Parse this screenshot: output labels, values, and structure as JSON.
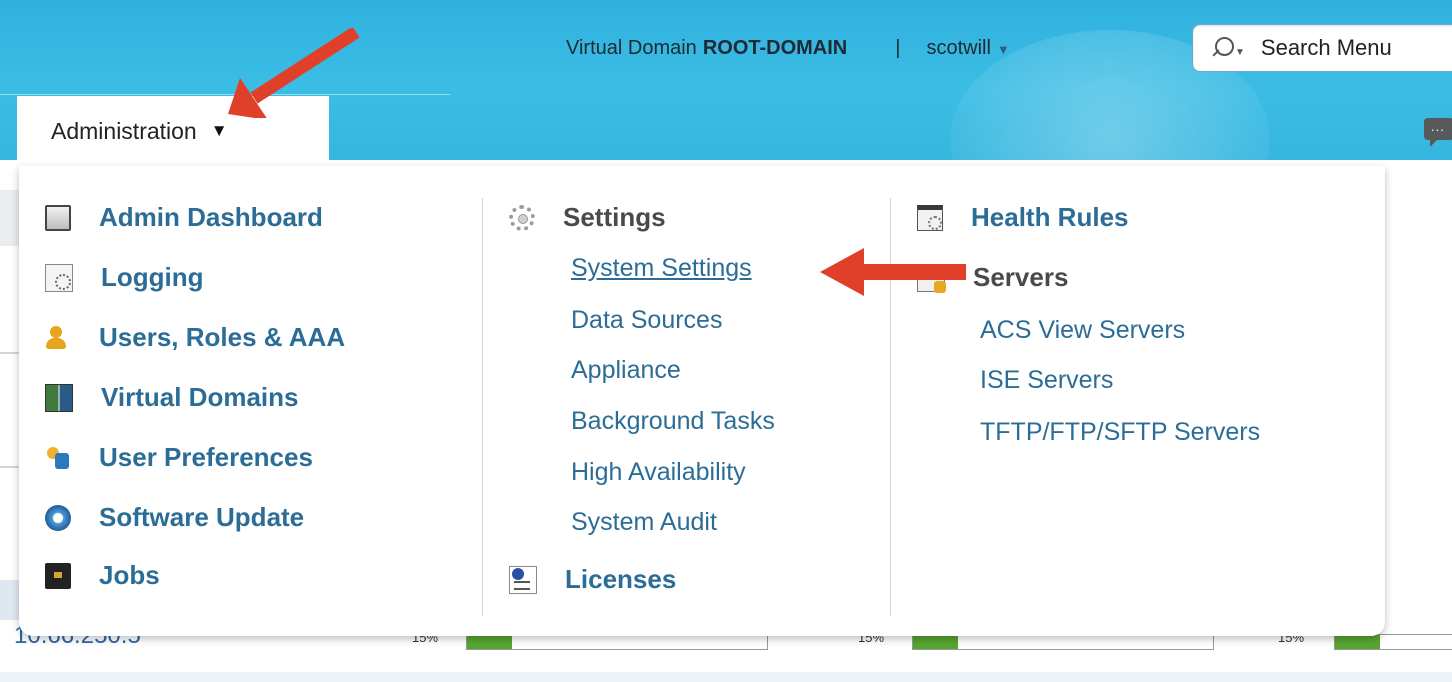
{
  "topbar": {
    "domain_prefix": "Virtual Domain",
    "domain_name": "ROOT-DOMAIN",
    "separator": "|",
    "user": "scotwill",
    "user_caret": "▼"
  },
  "search": {
    "placeholder": "Search Menu"
  },
  "admin_tab": {
    "label": "Administration",
    "caret": "▼"
  },
  "chat": {
    "dots": "..."
  },
  "menu": {
    "col1": [
      {
        "label": "Admin Dashboard",
        "icon": "dashboard-icon"
      },
      {
        "label": "Logging",
        "icon": "logging-icon"
      },
      {
        "label": "Users, Roles & AAA",
        "icon": "users-icon"
      },
      {
        "label": "Virtual Domains",
        "icon": "virtual-domains-icon"
      },
      {
        "label": "User Preferences",
        "icon": "user-preferences-icon"
      },
      {
        "label": "Software Update",
        "icon": "software-update-icon"
      },
      {
        "label": "Jobs",
        "icon": "jobs-icon"
      }
    ],
    "col2": {
      "settings": {
        "label": "Settings",
        "icon": "gear-icon",
        "items": [
          "System Settings",
          "Data Sources",
          "Appliance",
          "Background Tasks",
          "High Availability",
          "System Audit"
        ]
      },
      "licenses": {
        "label": "Licenses",
        "icon": "licenses-icon"
      }
    },
    "col3": {
      "health": {
        "label": "Health Rules",
        "icon": "health-rules-icon"
      },
      "servers": {
        "label": "Servers",
        "icon": "servers-icon",
        "items": [
          "ACS View Servers",
          "ISE Servers",
          "TFTP/FTP/SFTP Servers"
        ]
      }
    }
  },
  "background_row": {
    "ip": "10.66.250.5",
    "percent": "15%",
    "utilization_fraction": 0.15
  },
  "colors": {
    "header": "#36b6df",
    "link": "#2b6d96",
    "arrow": "#e0402a",
    "bar_fill": "#57a530"
  }
}
